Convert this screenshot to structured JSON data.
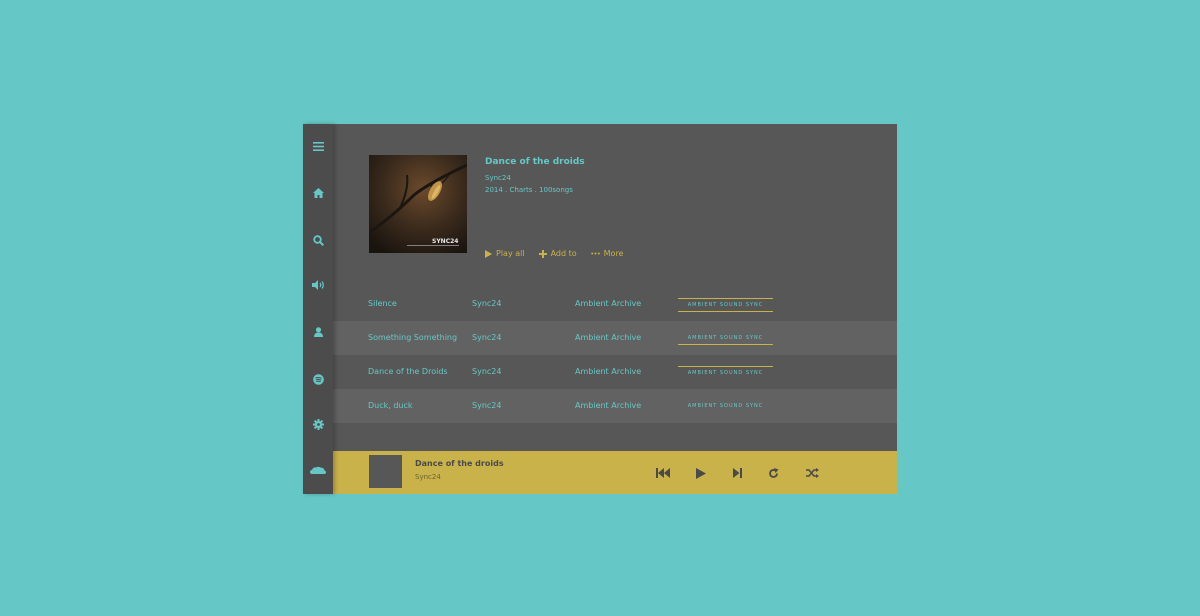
{
  "sidebar": {
    "icons": [
      "menu-icon",
      "home-icon",
      "search-icon",
      "volume-icon",
      "user-icon",
      "spotify-icon",
      "gear-icon",
      "cloud-icon"
    ]
  },
  "album": {
    "title": "Dance of the droids",
    "artist": "Sync24",
    "meta": "2014 . Charts . 100songs",
    "art_text": "SYNC24",
    "actions": [
      {
        "icon": "play-icon",
        "label": "Play all"
      },
      {
        "icon": "plus-icon",
        "label": "Add to"
      },
      {
        "icon": "more-icon",
        "label": "More"
      }
    ]
  },
  "tracks": [
    {
      "title": "Silence",
      "artist": "Sync24",
      "album": "Ambient Archive",
      "tag": "AMBIENT SOUND SYNC"
    },
    {
      "title": "Something Something",
      "artist": "Sync24",
      "album": "Ambient Archive",
      "tag": "AMBIENT SOUND SYNC"
    },
    {
      "title": "Dance of the Droids",
      "artist": "Sync24",
      "album": "Ambient Archive",
      "tag": "AMBIENT SOUND SYNC"
    },
    {
      "title": "Duck, duck",
      "artist": "Sync24",
      "album": "Ambient Archive",
      "tag": "AMBIENT SOUND SYNC"
    }
  ],
  "player": {
    "title": "Dance of the droids",
    "artist": "Sync24",
    "controls": [
      "previous-icon",
      "play-icon",
      "next-icon",
      "repeat-icon",
      "shuffle-icon"
    ]
  },
  "colors": {
    "background": "#65c8c6",
    "panel": "#575757",
    "sidebar": "#4c4c4c",
    "accent": "#c9b24a",
    "text": "#65c8c6"
  }
}
